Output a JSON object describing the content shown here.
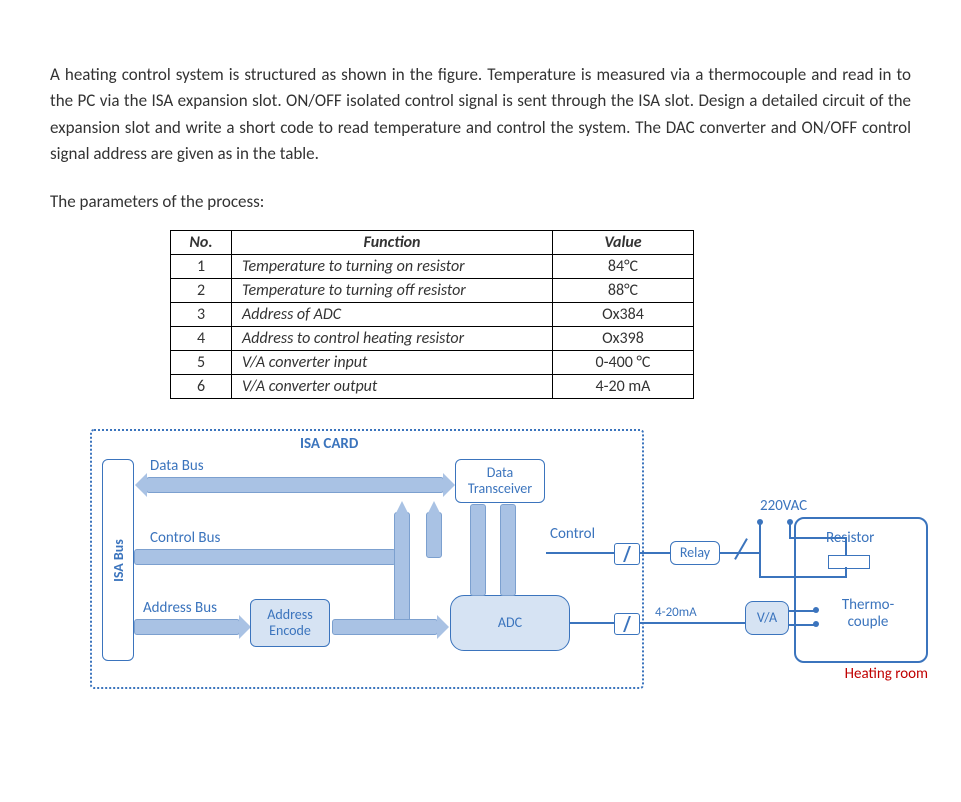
{
  "intro": "A heating control system is structured as shown in the figure. Temperature is measured via a thermocouple and read in to the PC via the ISA expansion slot. ON/OFF isolated control signal is sent through the ISA slot. Design a detailed circuit of the expansion slot and write a short code to read temperature and control the system. The DAC converter and ON/OFF control signal address are given as in the table.",
  "params_heading": "The parameters of the process:",
  "table": {
    "headers": {
      "no": "No.",
      "func": "Function",
      "val": "Value"
    },
    "rows": [
      {
        "no": "1",
        "func": "Temperature to turning on resistor",
        "val": "84°C"
      },
      {
        "no": "2",
        "func": "Temperature to turning off resistor",
        "val": "88°C"
      },
      {
        "no": "3",
        "func": "Address of ADC",
        "val": "Ox384"
      },
      {
        "no": "4",
        "func": "Address to control heating resistor",
        "val": "Ox398"
      },
      {
        "no": "5",
        "func": "V/A converter input",
        "val": "0-400 °C"
      },
      {
        "no": "6",
        "func": "V/A converter output",
        "val": "4-20 mA"
      }
    ]
  },
  "diagram": {
    "isa_card": "ISA CARD",
    "isa_bus": "ISA Bus",
    "data_bus": "Data Bus",
    "control_bus": "Control Bus",
    "address_bus": "Address Bus",
    "address_encode": "Address Encode",
    "data_transceiver": "Data Transceiver",
    "control": "Control",
    "adc": "ADC",
    "relay": "Relay",
    "va": "V/A",
    "resistor": "Resistor",
    "thermocouple": "Thermo-couple",
    "ac": "220VAC",
    "signal": "4-20mA",
    "heating_room": "Heating room"
  }
}
